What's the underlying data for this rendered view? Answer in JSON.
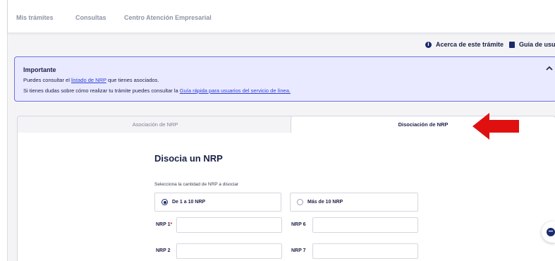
{
  "nav": {
    "items": [
      "Mis trámites",
      "Consultas",
      "Centro Atención Empresarial"
    ]
  },
  "links": {
    "about": "Acerca de este trámite",
    "guide": "Guía de usuar"
  },
  "notice": {
    "title": "Importante",
    "line1_prefix": "Puedes consultar el ",
    "line1_link": "listado de NRP",
    "line1_suffix": " que tienes asociados.",
    "line2_prefix": "Si tienes dudas sobre cómo realizar tu trámite puedes consultar la ",
    "line2_link": "Guía rápida para usuarios del servicio de línea."
  },
  "tabs": {
    "associate": "Asociación de NRP",
    "dissociate": "Disociación de NRP"
  },
  "form": {
    "heading": "Disocia un NRP",
    "select_label": "Selecciona la cantidad de NRP a disociar",
    "option_1": "De 1 a 10 NRP",
    "option_2": "Más de 10 NRP",
    "selected_option": "De 1 a 10 NRP",
    "nrp1": "NRP 1",
    "nrp1_required_mark": "*",
    "nrp2": "NRP 2",
    "nrp6": "NRP 6",
    "nrp7": "NRP 7"
  },
  "colors": {
    "accent": "#1b2a6b",
    "notice_bg": "#e9eaff",
    "notice_border": "#6f73d8",
    "annotation_arrow": "#e01010"
  },
  "icons": [
    "info-icon",
    "book-icon",
    "chevron-up-icon",
    "chat-icon",
    "red-arrow-annotation"
  ]
}
